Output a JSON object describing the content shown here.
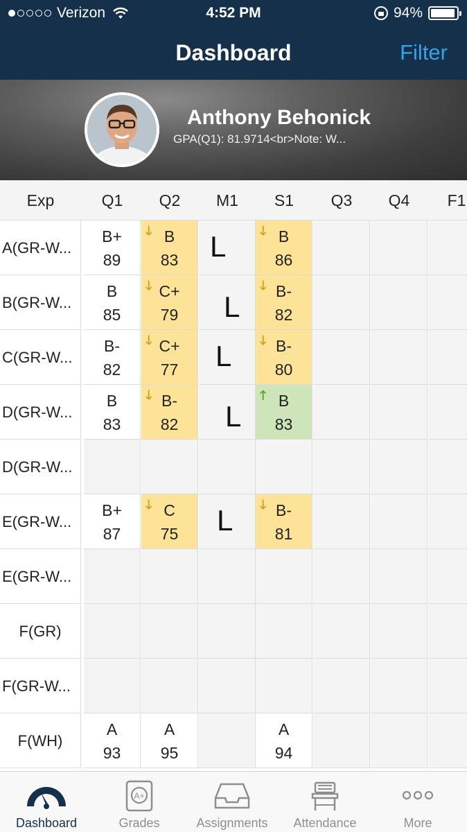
{
  "status_bar": {
    "carrier": "Verizon",
    "time": "4:52 PM",
    "battery": "94%",
    "battery_level": 0.94
  },
  "nav": {
    "title": "Dashboard",
    "filter_label": "Filter"
  },
  "profile": {
    "name": "Anthony Behonick",
    "gpa_text": "GPA(Q1): 81.9714<br>Note: W..."
  },
  "grid": {
    "columns": [
      "Exp",
      "Q1",
      "Q2",
      "M1",
      "S1",
      "Q3",
      "Q4",
      "F1"
    ],
    "rows": [
      {
        "label": "A(GR-W...",
        "q1": {
          "letter": "B+",
          "pct": "89"
        },
        "q2": {
          "letter": "B",
          "pct": "83"
        },
        "m1": "L",
        "s1": {
          "letter": "B",
          "pct": "86"
        }
      },
      {
        "label": "B(GR-W...",
        "q1": {
          "letter": "B",
          "pct": "85"
        },
        "q2": {
          "letter": "C+",
          "pct": "79"
        },
        "m1": "L",
        "s1": {
          "letter": "B-",
          "pct": "82"
        }
      },
      {
        "label": "C(GR-W...",
        "q1": {
          "letter": "B-",
          "pct": "82"
        },
        "q2": {
          "letter": "C+",
          "pct": "77"
        },
        "m1": "L",
        "s1": {
          "letter": "B-",
          "pct": "80"
        }
      },
      {
        "label": "D(GR-W...",
        "q1": {
          "letter": "B",
          "pct": "83"
        },
        "q2": {
          "letter": "B-",
          "pct": "82"
        },
        "m1": "L",
        "s1": {
          "letter": "B",
          "pct": "83"
        }
      },
      {
        "label": "D(GR-W..."
      },
      {
        "label": "E(GR-W...",
        "q1": {
          "letter": "B+",
          "pct": "87"
        },
        "q2": {
          "letter": "C",
          "pct": "75"
        },
        "m1": "L",
        "s1": {
          "letter": "B-",
          "pct": "81"
        }
      },
      {
        "label": "E(GR-W..."
      },
      {
        "label": "F(GR)"
      },
      {
        "label": "F(GR-W..."
      },
      {
        "label": "F(WH)",
        "q1": {
          "letter": "A",
          "pct": "93"
        },
        "q2": {
          "letter": "A",
          "pct": "95"
        },
        "s1": {
          "letter": "A",
          "pct": "94"
        }
      }
    ]
  },
  "tabs": [
    {
      "label": "Dashboard",
      "icon": "speedometer-icon"
    },
    {
      "label": "Grades",
      "icon": "grade-document-icon"
    },
    {
      "label": "Assignments",
      "icon": "inbox-tray-icon"
    },
    {
      "label": "Attendance",
      "icon": "desk-icon"
    },
    {
      "label": "More",
      "icon": "more-dots-icon"
    }
  ],
  "colors": {
    "nav_bg": "#14304a",
    "accent": "#3aa0e8",
    "grade_down": "#fde398",
    "grade_up": "#cde5b8"
  }
}
